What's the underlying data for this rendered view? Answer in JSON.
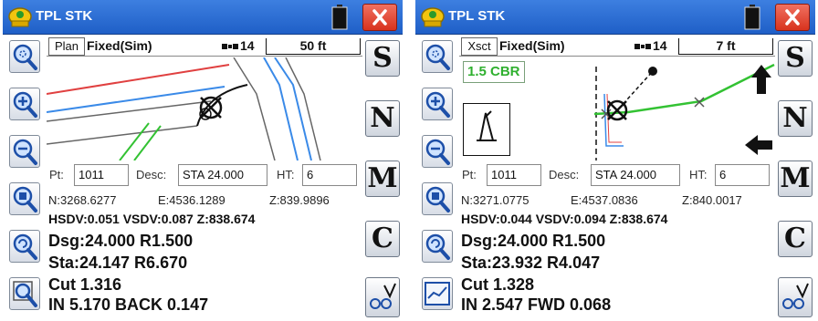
{
  "colors": {
    "titlebar": "#2a6fd6",
    "close": "#e0402b",
    "cbr_green": "#2fb02f",
    "road_red": "#e04040",
    "road_blue": "#3a8ae8",
    "road_green": "#33c233"
  },
  "icons": [
    "app-logo-icon",
    "battery-icon",
    "close-icon",
    "zoom-window-icon",
    "zoom-in-icon",
    "zoom-out-icon",
    "zoom-extents-icon",
    "zoom-previous-icon",
    "route-icon",
    "satellite-icon"
  ],
  "panes": [
    {
      "app_title": "TPL STK",
      "view_mode": "Plan",
      "fix_status": "Fixed(Sim)",
      "sat_count": "14",
      "scale": "50 ft",
      "letter_buttons": [
        "S",
        "N",
        "M",
        "C"
      ],
      "pt_label": "Pt:",
      "pt_value": "1011",
      "desc_label": "Desc:",
      "desc_value": "STA 24.000",
      "ht_label": "HT:",
      "ht_value": "6",
      "n": "N:3268.6277",
      "e": "E:4536.1289",
      "z": "Z:839.9896",
      "precision": "HSDV:0.051 VSDV:0.087 Z:838.674",
      "line1": "Dsg:24.000 R1.500",
      "line2": "Sta:24.147 R6.670",
      "line3": "Cut 1.316",
      "line4": "IN 5.170 BACK 0.147"
    },
    {
      "app_title": "TPL STK",
      "view_mode": "Xsct",
      "fix_status": "Fixed(Sim)",
      "sat_count": "14",
      "scale": "7 ft",
      "cbr": "1.5 CBR",
      "letter_buttons": [
        "S",
        "N",
        "M",
        "C"
      ],
      "pt_label": "Pt:",
      "pt_value": "1011",
      "desc_label": "Desc:",
      "desc_value": "STA 24.000",
      "ht_label": "HT:",
      "ht_value": "6",
      "n": "N:3271.0775",
      "e": "E:4537.0836",
      "z": "Z:840.0017",
      "precision": "HSDV:0.044 VSDV:0.094 Z:838.674",
      "line1": "Dsg:24.000 R1.500",
      "line2": "Sta:23.932 R4.047",
      "line3": "Cut 1.328",
      "line4": "IN 2.547 FWD 0.068"
    }
  ]
}
